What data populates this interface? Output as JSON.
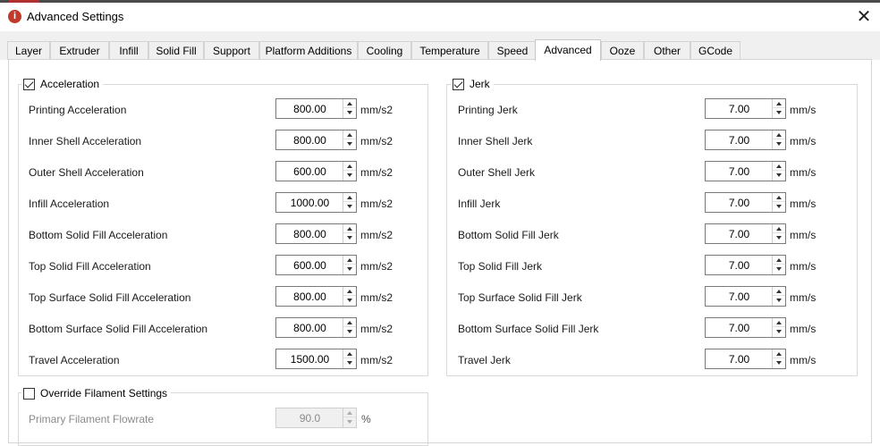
{
  "window": {
    "title": "Advanced Settings",
    "close_glyph": "✕",
    "app_icon_glyph": "i"
  },
  "tabs": [
    {
      "label": "Layer"
    },
    {
      "label": "Extruder"
    },
    {
      "label": "Infill"
    },
    {
      "label": "Solid Fill"
    },
    {
      "label": "Support"
    },
    {
      "label": "Platform Additions"
    },
    {
      "label": "Cooling"
    },
    {
      "label": "Temperature"
    },
    {
      "label": "Speed"
    },
    {
      "label": "Advanced",
      "active": true
    },
    {
      "label": "Ooze"
    },
    {
      "label": "Other"
    },
    {
      "label": "GCode"
    }
  ],
  "acceleration": {
    "title": "Acceleration",
    "checked": true,
    "rows": [
      {
        "label": "Printing Acceleration",
        "value": "800.00",
        "unit": "mm/s2"
      },
      {
        "label": "Inner Shell Acceleration",
        "value": "800.00",
        "unit": "mm/s2"
      },
      {
        "label": "Outer Shell Acceleration",
        "value": "600.00",
        "unit": "mm/s2"
      },
      {
        "label": "Infill Acceleration",
        "value": "1000.00",
        "unit": "mm/s2"
      },
      {
        "label": "Bottom Solid Fill Acceleration",
        "value": "800.00",
        "unit": "mm/s2"
      },
      {
        "label": "Top Solid Fill Acceleration",
        "value": "600.00",
        "unit": "mm/s2"
      },
      {
        "label": "Top Surface Solid Fill Acceleration",
        "value": "800.00",
        "unit": "mm/s2"
      },
      {
        "label": "Bottom Surface Solid Fill Acceleration",
        "value": "800.00",
        "unit": "mm/s2"
      },
      {
        "label": "Travel Acceleration",
        "value": "1500.00",
        "unit": "mm/s2"
      }
    ]
  },
  "jerk": {
    "title": "Jerk",
    "checked": true,
    "rows": [
      {
        "label": "Printing Jerk",
        "value": "7.00",
        "unit": "mm/s"
      },
      {
        "label": "Inner Shell Jerk",
        "value": "7.00",
        "unit": "mm/s"
      },
      {
        "label": "Outer Shell Jerk",
        "value": "7.00",
        "unit": "mm/s"
      },
      {
        "label": "Infill Jerk",
        "value": "7.00",
        "unit": "mm/s"
      },
      {
        "label": "Bottom Solid Fill Jerk",
        "value": "7.00",
        "unit": "mm/s"
      },
      {
        "label": "Top Solid Fill Jerk",
        "value": "7.00",
        "unit": "mm/s"
      },
      {
        "label": "Top Surface Solid Fill Jerk",
        "value": "7.00",
        "unit": "mm/s"
      },
      {
        "label": "Bottom Surface Solid Fill Jerk",
        "value": "7.00",
        "unit": "mm/s"
      },
      {
        "label": "Travel Jerk",
        "value": "7.00",
        "unit": "mm/s"
      }
    ]
  },
  "filament": {
    "title": "Override Filament Settings",
    "checked": false,
    "rows": [
      {
        "label": "Primary Filament Flowrate",
        "value": "90.0",
        "unit": "%",
        "disabled": true
      }
    ]
  },
  "icons": {
    "app": "app-logo-icon",
    "close": "close-icon",
    "checkbox": "checkbox-icon",
    "spin_up": "spin-up-icon",
    "spin_down": "spin-down-icon"
  },
  "colors": {
    "accent": "#c0392b",
    "tab_bg": "#f0f0f0",
    "border": "#d4d4d4"
  }
}
